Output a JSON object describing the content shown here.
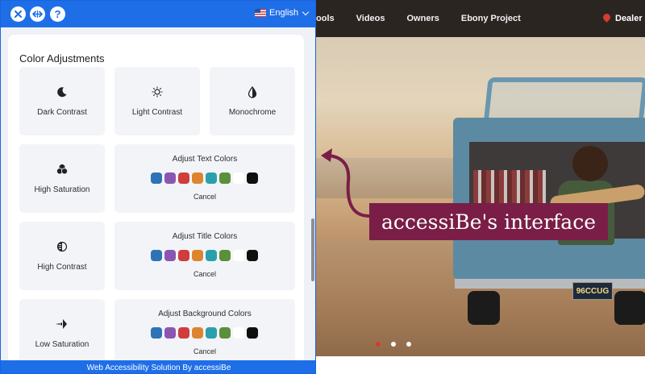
{
  "site": {
    "nav_links": [
      "ools",
      "Videos",
      "Owners",
      "Ebony Project"
    ],
    "dealer_label": "Dealer",
    "license_plate": "96CCUG",
    "callout_text": "accessiBe's interface",
    "carousel_dots": 3,
    "carousel_active_dot": 1
  },
  "panel": {
    "header": {
      "close_icon": "close-icon",
      "move_icon": "resize-horizontal-icon",
      "help_label": "?",
      "language_label": "English"
    },
    "section_title": "Color Adjustments",
    "cards": {
      "dark_contrast": "Dark Contrast",
      "light_contrast": "Light Contrast",
      "monochrome": "Monochrome",
      "high_saturation": "High Saturation",
      "high_contrast": "High Contrast",
      "low_saturation": "Low Saturation"
    },
    "color_cards": {
      "text": {
        "title": "Adjust Text Colors",
        "cancel": "Cancel"
      },
      "title": {
        "title": "Adjust Title Colors",
        "cancel": "Cancel"
      },
      "background": {
        "title": "Adjust Background Colors",
        "cancel": "Cancel"
      }
    },
    "swatch_colors": [
      "#2f73b7",
      "#8b56b2",
      "#cf3d3d",
      "#de8430",
      "#2aa0ad",
      "#5a8f3c",
      "#ffffff",
      "#0f0f0f"
    ],
    "footer": "Web Accessibility Solution By accessiBe"
  },
  "colors": {
    "accent": "#1e6ee8",
    "callout": "#7a1e47",
    "nav_bg": "#2b2522"
  }
}
